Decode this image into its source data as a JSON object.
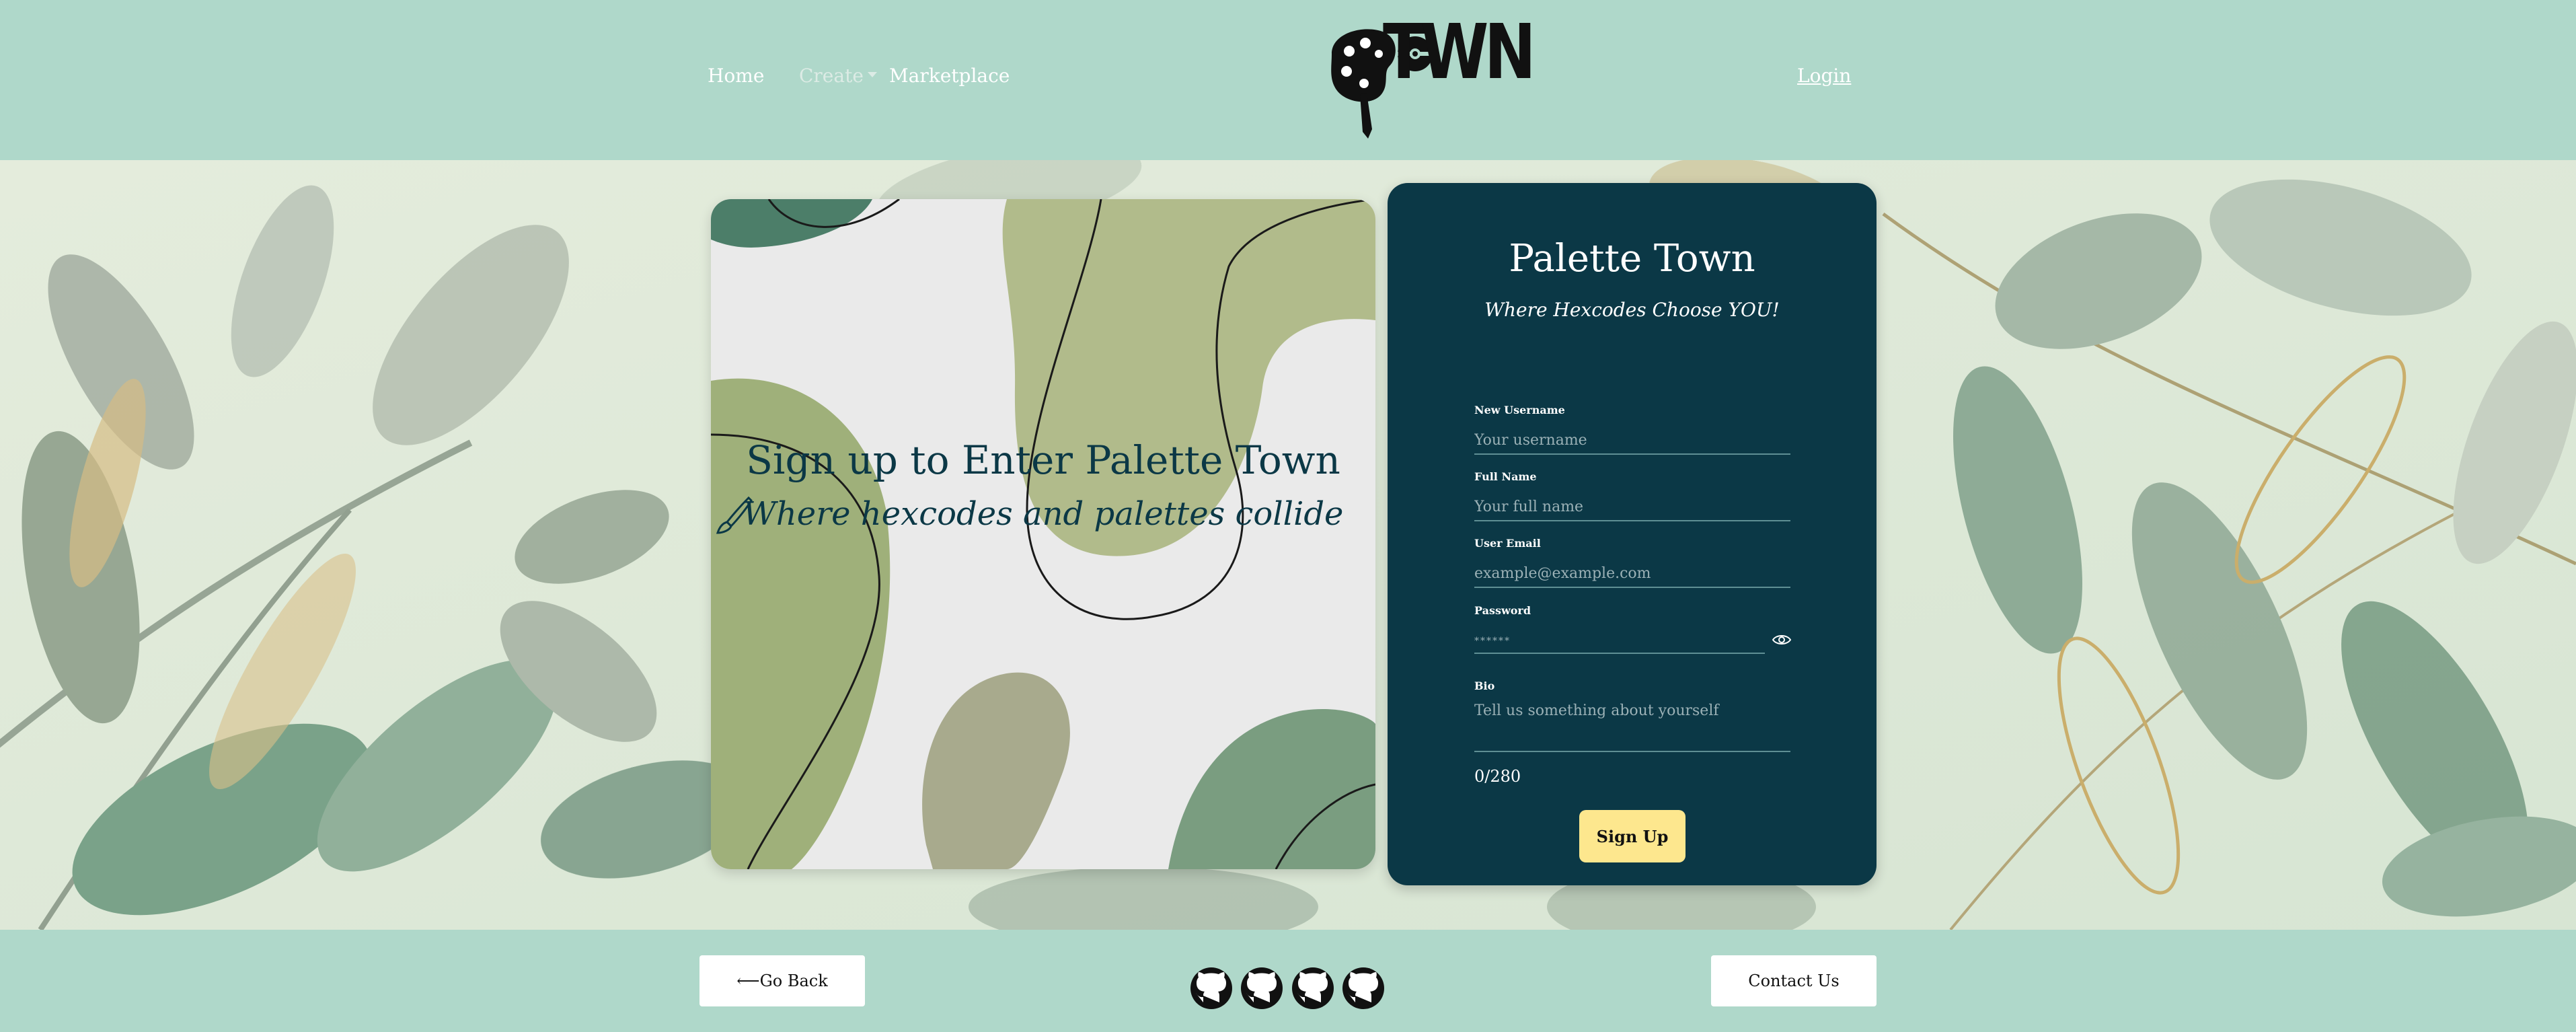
{
  "nav": {
    "home": "Home",
    "create": "Create",
    "marketplace": "Marketplace",
    "login": "Login",
    "logo_text": "TWN"
  },
  "art": {
    "title": "Sign up to Enter Palette Town",
    "subtitle": "Where hexcodes and palettes collide",
    "subtitle_icon": "brush-icon"
  },
  "form": {
    "title": "Palette Town",
    "subtitle": "Where Hexcodes Choose YOU!",
    "fields": [
      {
        "label": "New Username",
        "placeholder": "Your username",
        "value": ""
      },
      {
        "label": "Full Name",
        "placeholder": "Your full name",
        "value": ""
      },
      {
        "label": "User Email",
        "placeholder": "example@example.com",
        "value": ""
      },
      {
        "label": "Password",
        "placeholder": "******",
        "value": ""
      },
      {
        "label": "Bio",
        "placeholder": "Tell us something about yourself",
        "value": ""
      }
    ],
    "password_toggle_icon": "eye-icon",
    "char_count": "0/280",
    "submit": "Sign Up"
  },
  "footer": {
    "back": "⟵Go Back",
    "contact": "Contact Us",
    "social_icons": [
      "github-icon",
      "github-icon",
      "github-icon",
      "github-icon"
    ]
  },
  "colors": {
    "header_bg": "#afd8ca",
    "form_bg": "#0b3846",
    "button_yellow": "#fde78e",
    "art_green_light": "#b1bb8b",
    "art_green_mid": "#9fb07a",
    "art_green_dark": "#4c7e69",
    "art_gray": "#eaeaea"
  }
}
